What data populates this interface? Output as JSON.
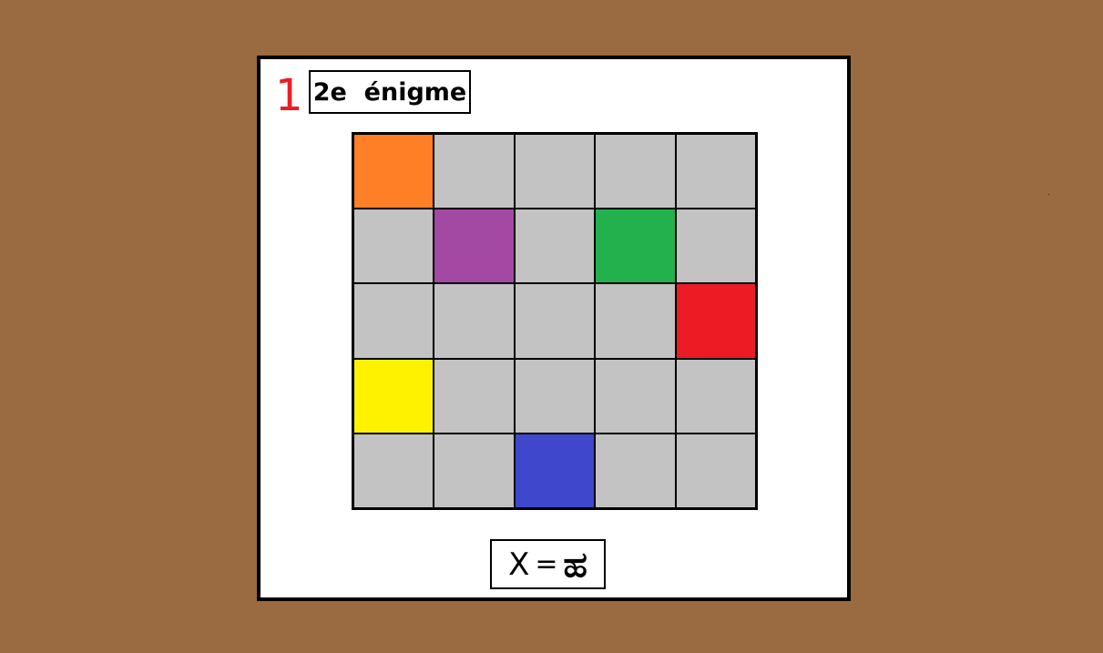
{
  "puzzle": {
    "number": "1",
    "title": "2e  énigme"
  },
  "grid": {
    "rows": 5,
    "cols": 5,
    "default_color": "#c3c3c3",
    "colored_cells": [
      {
        "row": 0,
        "col": 0,
        "color": "#ff7f27",
        "name": "orange"
      },
      {
        "row": 1,
        "col": 1,
        "color": "#a349a4",
        "name": "purple"
      },
      {
        "row": 1,
        "col": 3,
        "color": "#22b14c",
        "name": "green"
      },
      {
        "row": 2,
        "col": 4,
        "color": "#ed1c24",
        "name": "red"
      },
      {
        "row": 3,
        "col": 0,
        "color": "#fff200",
        "name": "yellow"
      },
      {
        "row": 4,
        "col": 2,
        "color": "#3f48cc",
        "name": "blue"
      }
    ]
  },
  "answer": {
    "label": "X",
    "equals": "=",
    "value": "ಹ"
  },
  "colors": {
    "background": "#9a6b40",
    "card": "#ffffff",
    "number": "#ed1c24"
  }
}
